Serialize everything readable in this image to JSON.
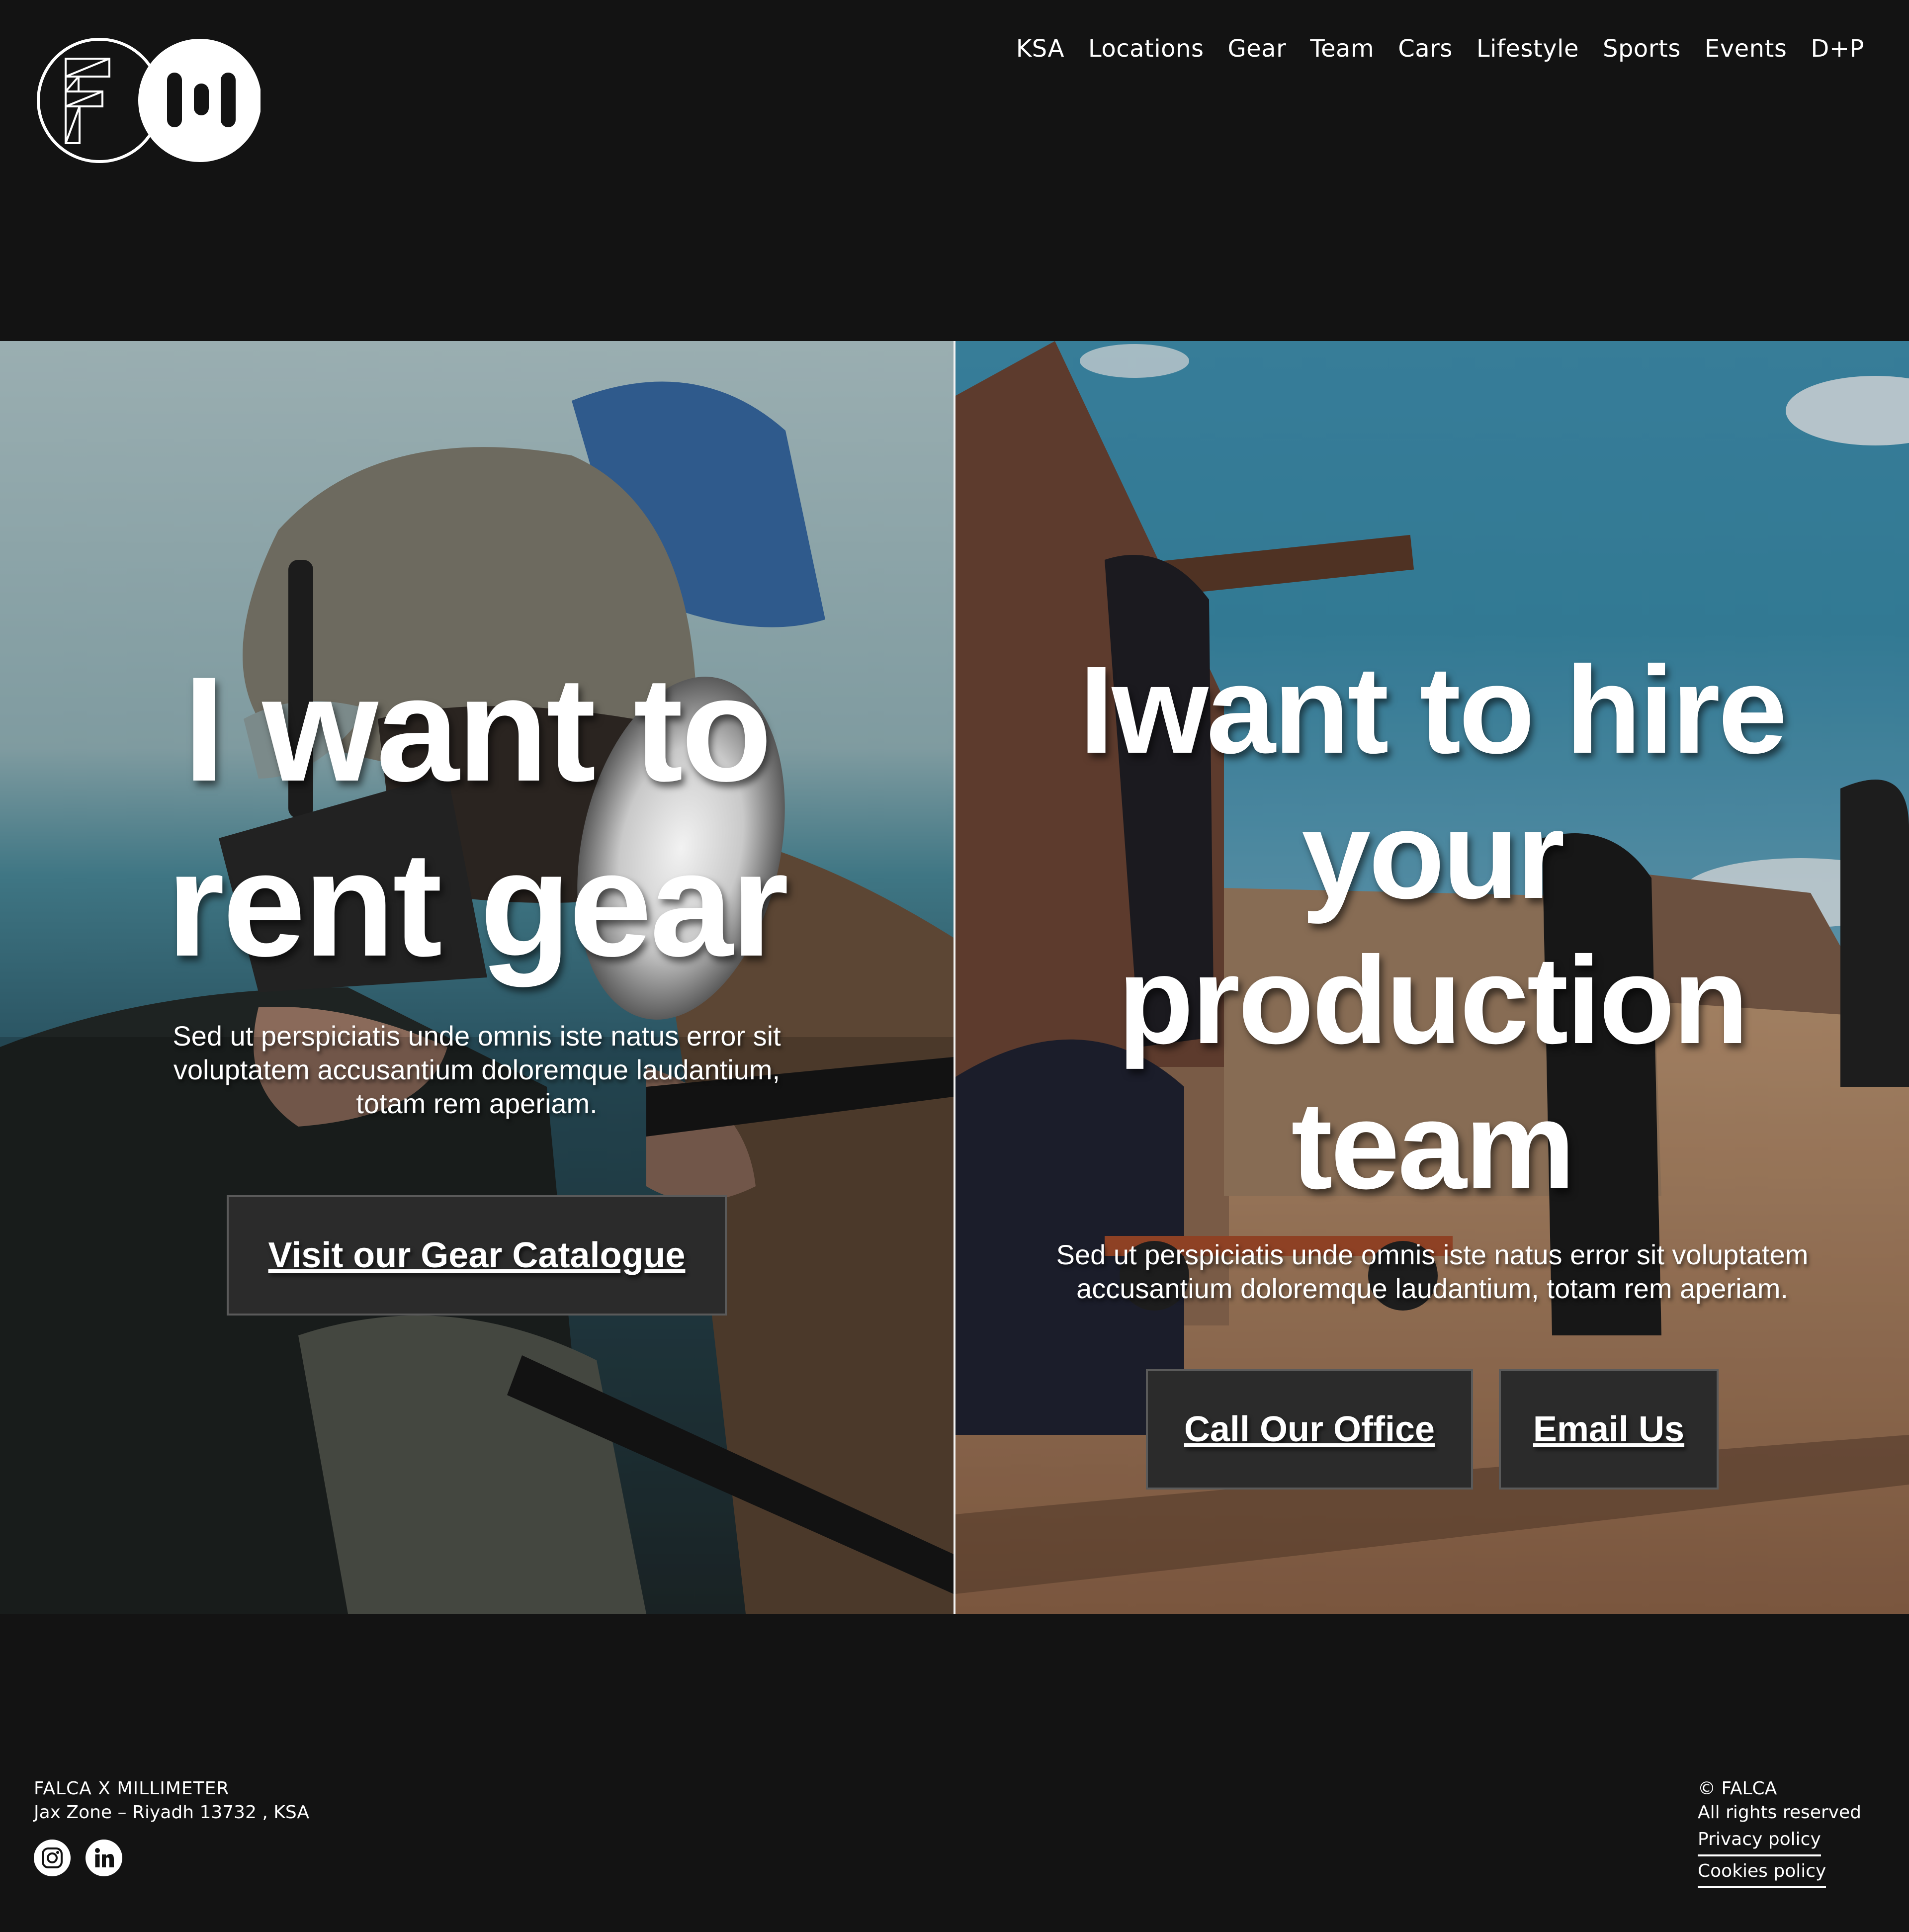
{
  "brand": {
    "logo_name": "FALCA x Millimeter"
  },
  "nav": {
    "items": [
      {
        "label": "KSA"
      },
      {
        "label": "Locations"
      },
      {
        "label": "Gear"
      },
      {
        "label": "Team"
      },
      {
        "label": "Cars"
      },
      {
        "label": "Lifestyle"
      },
      {
        "label": "Sports"
      },
      {
        "label": "Events"
      },
      {
        "label": "D+P"
      }
    ]
  },
  "hero": {
    "left": {
      "headline_lines": [
        "I want to",
        "rent gear"
      ],
      "description": "Sed ut perspiciatis unde omnis iste natus error sit voluptatem accusantium doloremque laudantium, totam rem aperiam.",
      "cta_label": "Visit our Gear Catalogue",
      "image": "photographer-with-camera-rig"
    },
    "right": {
      "headline_lines": [
        "Iwant to hire",
        "your",
        "production",
        "team"
      ],
      "description": "Sed ut perspiciatis unde omnis iste natus error sit voluptatem accusantium doloremque laudantium, totam rem aperiam.",
      "call_label": "Call Our Office",
      "email_label": "Email Us",
      "image": "film-crew-on-western-set"
    }
  },
  "footer": {
    "company": "FALCA X MILLIMETER",
    "address": "Jax Zone – Riyadh 13732 , KSA",
    "socials": [
      {
        "icon": "instagram-icon"
      },
      {
        "icon": "linkedin-icon"
      }
    ],
    "copyright": "© FALCA",
    "rights": "All rights reserved",
    "privacy_label": "Privacy policy",
    "cookies_label": "Cookies policy"
  },
  "colors": {
    "background": "#131313",
    "button_bg": "#2b2b2b",
    "button_border": "#5a5a5a",
    "text": "#ffffff"
  }
}
